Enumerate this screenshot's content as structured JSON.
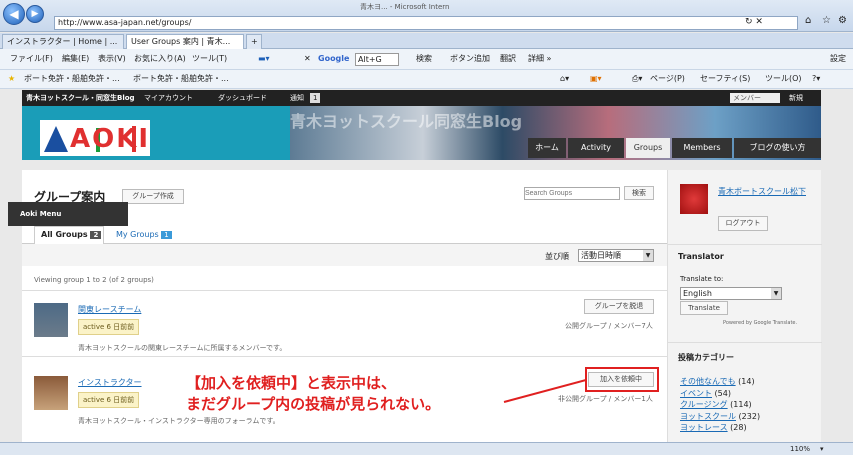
{
  "browser": {
    "url": "http://www.asa-japan.net/groups/",
    "window_title": "青木ヨ... - Microsoft Intern",
    "search_hint": "ログイン",
    "tabs": [
      "インストラクター | Home | ...",
      "User Groups 案内 | 青木..."
    ],
    "menu": [
      "ファイル(F)",
      "編集(E)",
      "表示(V)",
      "お気に入り(A)",
      "ツール(T)"
    ],
    "google_input": "Alt+G",
    "toolbar_items": [
      "検索",
      "ボタン追加",
      "翻訳",
      "詳細 »"
    ],
    "settings": "設定",
    "favorites": [
      "ボート免許・船舶免許・...",
      "ボート免許・船舶免許・..."
    ],
    "commandbar": [
      "ページ(P)",
      "セーフティ(S)",
      "ツール(O)"
    ],
    "zoom": "110%"
  },
  "site": {
    "adminbar": [
      "青木ヨットスクール・同窓生Blog",
      "マイアカウント",
      "ダッシュボード",
      "通知",
      "1",
      "メンバー",
      "新規"
    ],
    "blog_title": "青木ヨットスクール同窓生Blog",
    "logo": "AOKI",
    "nav": [
      "ホーム",
      "Activity",
      "Groups",
      "Members",
      "ブログの使い方"
    ],
    "aoki_menu": "Aoki Menu"
  },
  "main": {
    "title": "グループ案内",
    "create_btn": "グループ作成",
    "search_placeholder": "Search Groups",
    "search_btn": "検索",
    "tab_all": "All Groups",
    "tab_all_count": "2",
    "tab_my": "My Groups",
    "tab_my_count": "1",
    "sort_label": "並び順",
    "sort_value": "活動日時順",
    "viewing": "Viewing group 1 to 2 (of 2 groups)",
    "groups": [
      {
        "name": "関東レースチーム",
        "active": "active 6 日前前",
        "btn": "グループを脱退",
        "meta": "公開グループ / メンバー7人",
        "desc": "青木ヨットスクールの関東レースチームに所属するメンバーです。"
      },
      {
        "name": "インストラクター",
        "active": "active 6 日前前",
        "btn": "加入を依頼中",
        "meta": "非公開グループ / メンバー1人",
        "desc": "青木ヨットスクール・インストラクター専用のフォーラムです。"
      }
    ]
  },
  "sidebar": {
    "user": "青木ボートスクール松下",
    "logout": "ログアウト",
    "translator_title": "Translator",
    "translate_to": "Translate to:",
    "lang": "English",
    "translate_btn": "Translate",
    "powered": "Powered by Google Translate.",
    "cat_title": "投稿カテゴリー",
    "cats": [
      [
        "その他なんでも",
        "(14)"
      ],
      [
        "イベント",
        "(54)"
      ],
      [
        "クルージング",
        "(114)"
      ],
      [
        "ヨットスクール",
        "(232)"
      ],
      [
        "ヨットレース",
        "(28)"
      ]
    ]
  },
  "annotation": {
    "line1": "【加入を依頼中】と表示中は、",
    "line2": "まだグループ内の投稿が見られない。"
  }
}
